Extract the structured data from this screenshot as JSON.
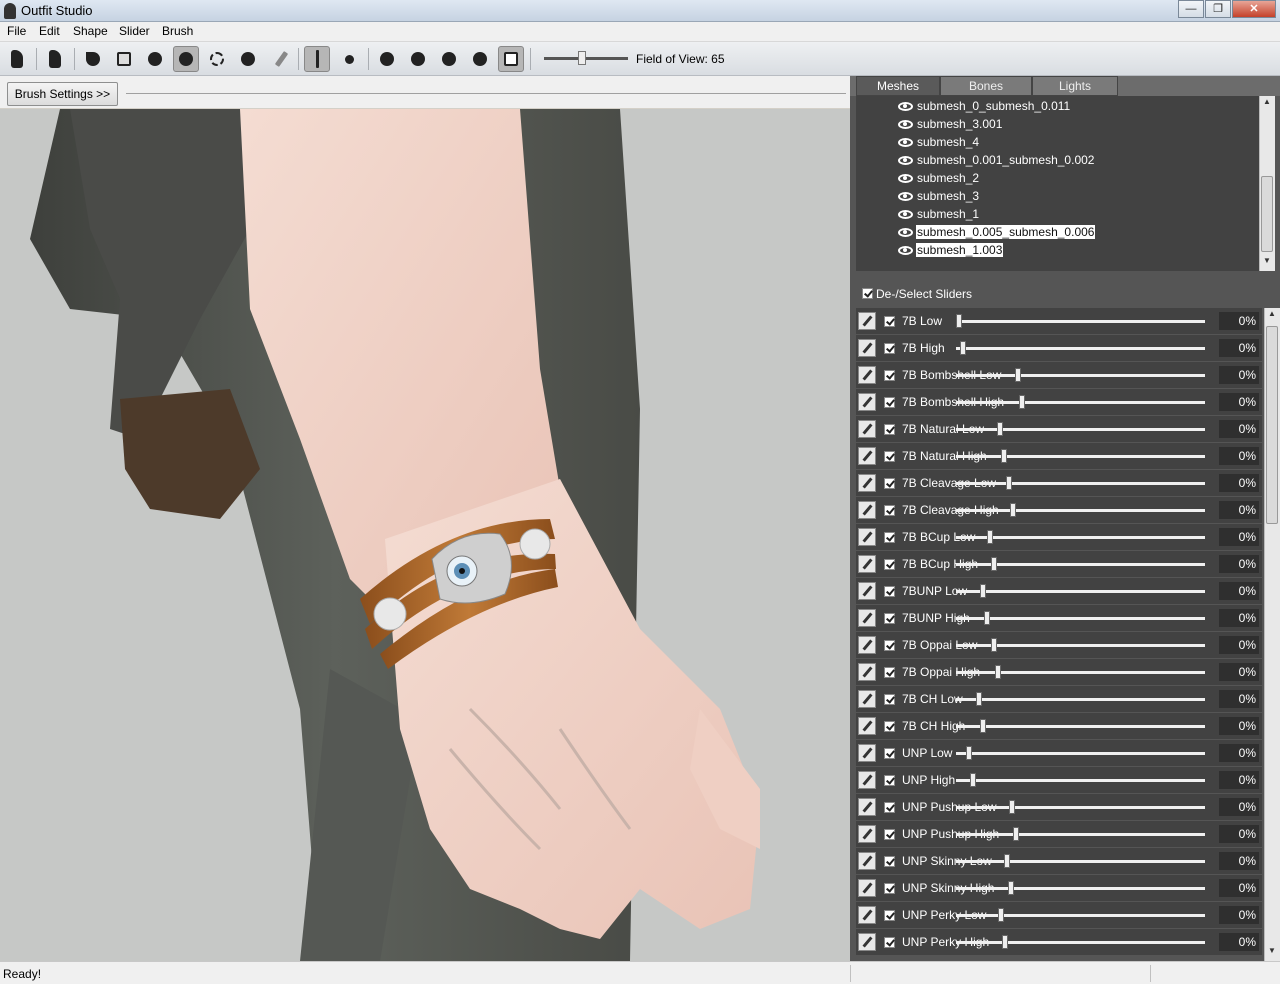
{
  "window": {
    "title": "Outfit Studio",
    "minimize_glyph": "—",
    "restore_glyph": "❐",
    "close_glyph": "✕"
  },
  "menu": [
    "File",
    "Edit",
    "Shape",
    "Slider",
    "Brush"
  ],
  "toolbar": {
    "field_of_view_label": "Field of View: 65",
    "field_of_view_value": 65
  },
  "brush_settings_label": "Brush Settings >>",
  "tabs": [
    "Meshes",
    "Bones",
    "Lights"
  ],
  "meshes": [
    {
      "name": "submesh_0_submesh_0.011",
      "selected": false
    },
    {
      "name": "submesh_3.001",
      "selected": false
    },
    {
      "name": "submesh_4",
      "selected": false
    },
    {
      "name": "submesh_0.001_submesh_0.002",
      "selected": false
    },
    {
      "name": "submesh_2",
      "selected": false
    },
    {
      "name": "submesh_3",
      "selected": false
    },
    {
      "name": "submesh_1",
      "selected": false
    },
    {
      "name": "submesh_0.005_submesh_0.006",
      "selected": true
    },
    {
      "name": "submesh_1.003",
      "selected": true
    }
  ],
  "deselect_label": "De-/Select Sliders",
  "sliders": [
    {
      "label": "7B Low",
      "value": "0%"
    },
    {
      "label": "7B High",
      "value": "0%"
    },
    {
      "label": "7B Bombshell Low",
      "value": "0%"
    },
    {
      "label": "7B Bombshell High",
      "value": "0%"
    },
    {
      "label": "7B Natural Low",
      "value": "0%"
    },
    {
      "label": "7B Natural High",
      "value": "0%"
    },
    {
      "label": "7B Cleavage Low",
      "value": "0%"
    },
    {
      "label": "7B Cleavage High",
      "value": "0%"
    },
    {
      "label": "7B BCup Low",
      "value": "0%"
    },
    {
      "label": "7B BCup High",
      "value": "0%"
    },
    {
      "label": "7BUNP Low",
      "value": "0%"
    },
    {
      "label": "7BUNP High",
      "value": "0%"
    },
    {
      "label": "7B Oppai Low",
      "value": "0%"
    },
    {
      "label": "7B Oppai High",
      "value": "0%"
    },
    {
      "label": "7B CH Low",
      "value": "0%"
    },
    {
      "label": "7B CH High",
      "value": "0%"
    },
    {
      "label": "UNP Low",
      "value": "0%"
    },
    {
      "label": "UNP High",
      "value": "0%"
    },
    {
      "label": "UNP Pushup Low",
      "value": "0%"
    },
    {
      "label": "UNP Pushup High",
      "value": "0%"
    },
    {
      "label": "UNP Skinny Low",
      "value": "0%"
    },
    {
      "label": "UNP Skinny High",
      "value": "0%"
    },
    {
      "label": "UNP Perky Low",
      "value": "0%"
    },
    {
      "label": "UNP Perky High",
      "value": "0%"
    }
  ],
  "status": "Ready!"
}
